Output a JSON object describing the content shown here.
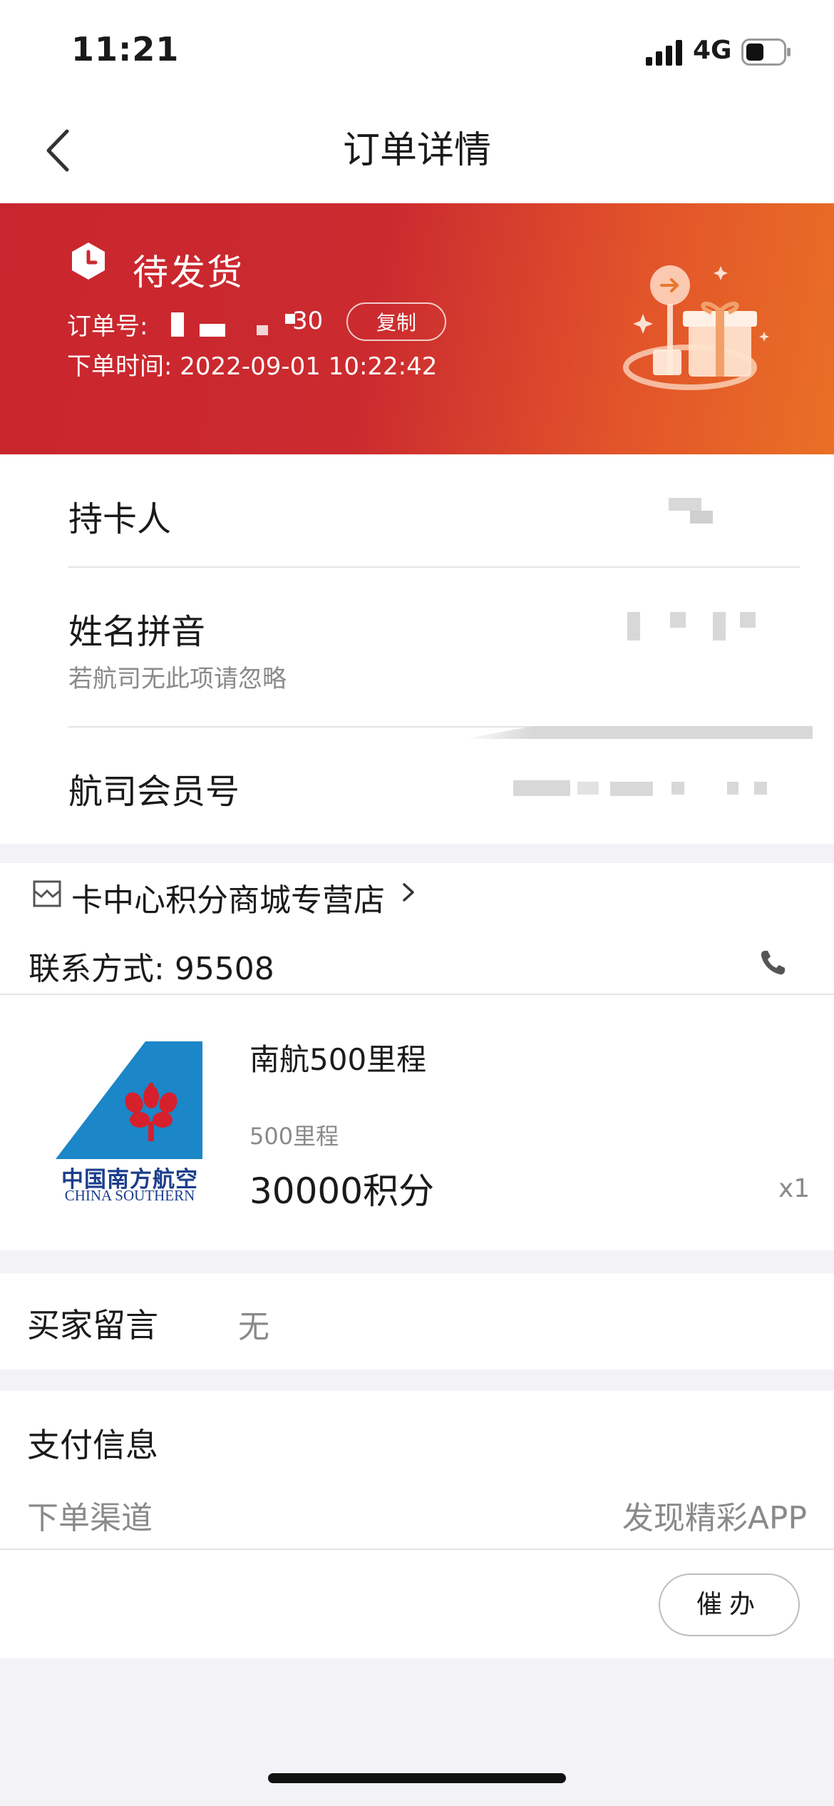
{
  "status_bar": {
    "time": "11:21",
    "network": "4G"
  },
  "nav": {
    "title": "订单详情"
  },
  "order": {
    "status": "待发货",
    "order_no_label": "订单号:",
    "order_no_tail": "30",
    "copy_label": "复制",
    "time_label": "下单时间:",
    "time_value": "2022-09-01 10:22:42"
  },
  "holder": {
    "card_holder_label": "持卡人",
    "pinyin_label": "姓名拼音",
    "pinyin_hint": "若航司无此项请忽略",
    "member_no_label": "航司会员号"
  },
  "store": {
    "name": "卡中心积分商城专营店",
    "contact_label": "联系方式:",
    "contact_value": "95508"
  },
  "product": {
    "name": "南航500里程",
    "spec": "500里程",
    "price": "30000积分",
    "qty": "x1",
    "logo_cn": "中国南方航空",
    "logo_en": "CHINA SOUTHERN"
  },
  "buyer_message": {
    "label": "买家留言",
    "value": "无"
  },
  "payment": {
    "title": "支付信息",
    "channel_label": "下单渠道",
    "channel_value": "发现精彩APP"
  },
  "actions": {
    "urge_label": "催办"
  },
  "colors": {
    "hero_start": "#c9252e",
    "hero_end": "#e97025",
    "logo_blue": "#1b86c8",
    "logo_red": "#d6202c"
  }
}
